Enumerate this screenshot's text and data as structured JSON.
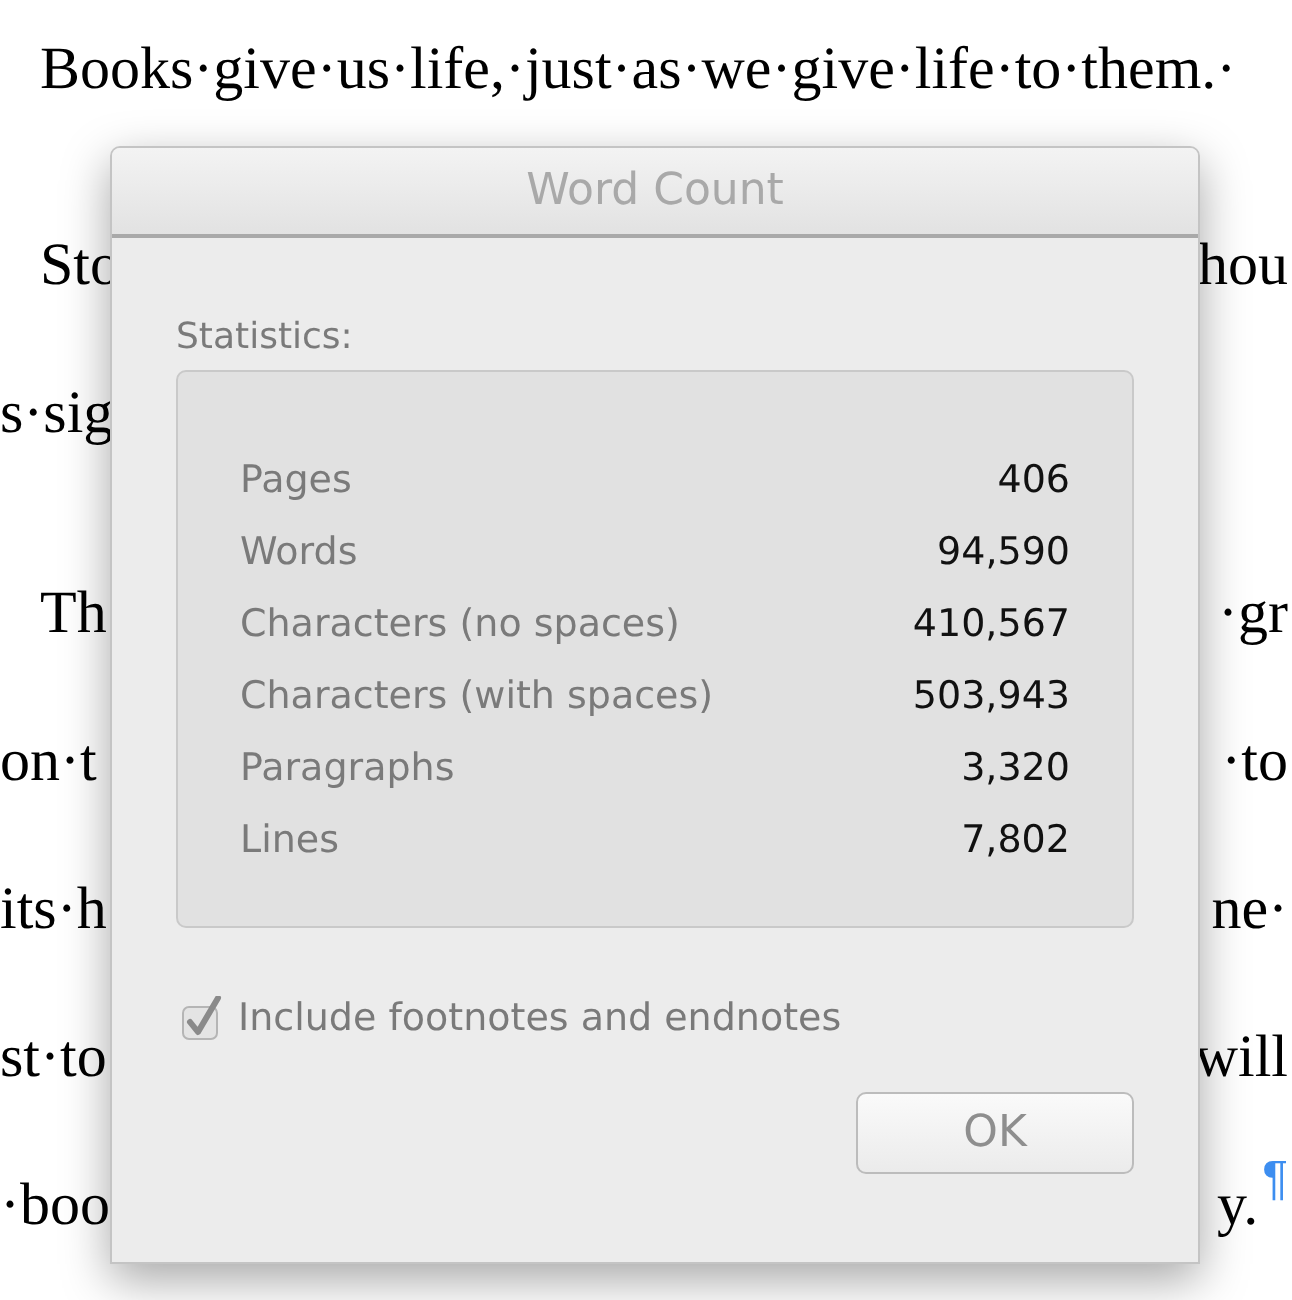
{
  "document": {
    "lines": [
      {
        "kind": "indented",
        "left": "Books·give·us·life,·just·as·we·give·life·to·them.·"
      },
      {
        "kind": "indented",
        "left": "Sto",
        "right": "hou"
      },
      {
        "kind": "plain",
        "left": "s·sig"
      },
      {
        "kind": "indented",
        "left": "Th",
        "right": "·gr"
      },
      {
        "kind": "plain",
        "left": "on·t",
        "right": "·to"
      },
      {
        "kind": "plain",
        "left": "its·h",
        "right": "ne·"
      },
      {
        "kind": "plain",
        "left": "st·to",
        "right": "will"
      },
      {
        "kind": "plain",
        "left": "·boo",
        "right": "y.",
        "pilcrow": "¶"
      }
    ]
  },
  "dialog": {
    "title": "Word Count",
    "section_label": "Statistics:",
    "stats": [
      {
        "label": "Pages",
        "value": "406"
      },
      {
        "label": "Words",
        "value": "94,590"
      },
      {
        "label": "Characters (no spaces)",
        "value": "410,567"
      },
      {
        "label": "Characters (with spaces)",
        "value": "503,943"
      },
      {
        "label": "Paragraphs",
        "value": "3,320"
      },
      {
        "label": "Lines",
        "value": "7,802"
      }
    ],
    "checkbox": {
      "label": "Include footnotes and endnotes",
      "checked": true,
      "disabled": true
    },
    "button": {
      "label": "OK",
      "disabled": true
    }
  }
}
